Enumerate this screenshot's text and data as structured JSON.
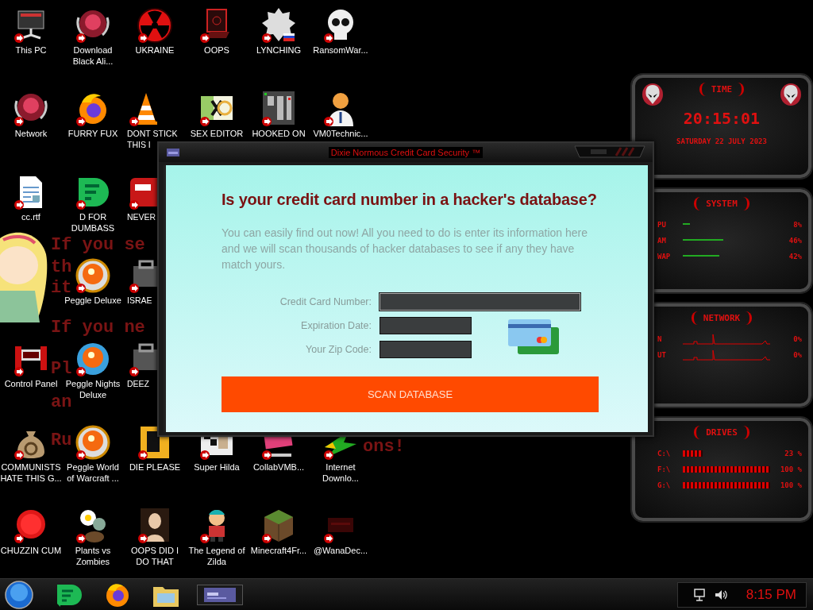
{
  "desktop": {
    "wallpaper_text": [
      "If you se",
      "th",
      "it",
      "If you ne",
      "Pl",
      "an",
      "Ru",
      "ons!"
    ],
    "icon_rows": [
      [
        {
          "label": "This PC",
          "covered": false
        },
        {
          "label": "Download Black Ali...",
          "covered": false
        },
        {
          "label": "UKRAINE",
          "covered": false
        },
        {
          "label": "OOPS",
          "covered": false
        },
        {
          "label": "LYNCHING",
          "covered": false
        },
        {
          "label": "RansomWar...",
          "covered": false
        }
      ],
      [
        {
          "label": "Network",
          "covered": false
        },
        {
          "label": "FURRY FUX",
          "covered": false
        },
        {
          "label": "DONT STICK THIS I",
          "covered": true
        },
        {
          "label": "SEX EDITOR",
          "covered": false
        },
        {
          "label": "HOOKED ON",
          "covered": false
        },
        {
          "label": "VM0Technic...",
          "covered": false
        }
      ],
      [
        {
          "label": "cc.rtf",
          "covered": false
        },
        {
          "label": "D FOR DUMBASS",
          "covered": false
        },
        {
          "label": "NEVER",
          "covered": true
        }
      ],
      [
        {
          "label": "Peggle Deluxe",
          "covered": false
        },
        {
          "label": "ISRAE",
          "covered": true
        }
      ],
      [
        {
          "label": "Control Panel",
          "covered": false
        },
        {
          "label": "Peggle Nights Deluxe",
          "covered": false
        },
        {
          "label": "DEEZ",
          "covered": true
        }
      ],
      [
        {
          "label": "COMMUNISTS HATE THIS G...",
          "covered": false
        },
        {
          "label": "Peggle World of Warcraft ...",
          "covered": false
        },
        {
          "label": "DIE PLEASE",
          "covered": false
        },
        {
          "label": "Super Hilda",
          "covered": false
        },
        {
          "label": "CollabVMB...",
          "covered": false
        },
        {
          "label": "Internet Downlo...",
          "covered": false
        }
      ],
      [
        {
          "label": "CHUZZIN CUM",
          "covered": false
        },
        {
          "label": "Plants vs Zombies",
          "covered": false
        },
        {
          "label": "OOPS DID I DO THAT",
          "covered": false
        },
        {
          "label": "The Legend of Zilda",
          "covered": false
        },
        {
          "label": "Minecraft4Fr...",
          "covered": false
        },
        {
          "label": "@WanaDec...",
          "covered": false
        }
      ]
    ]
  },
  "window": {
    "title": "Dixie Normous Credit Card Security ™",
    "heading": "Is your credit card number in a hacker's database?",
    "intro": "You can easily find out now! All you need to do is enter its information here and we will scan thousands of hacker databases to see if any they have match yours.",
    "fields": [
      {
        "label": "Credit Card Number:",
        "focused": true
      },
      {
        "label": "Expiration Date:",
        "focused": false
      },
      {
        "label": "Your Zip Code:",
        "focused": false
      }
    ],
    "button": "SCAN DATABASE"
  },
  "gadget": {
    "time": {
      "header": "TIME",
      "clock": "20:15:01",
      "date": "SATURDAY 22 JULY 2023"
    },
    "system": {
      "header": "SYSTEM",
      "rows": [
        {
          "label": "PU",
          "reading": "8%"
        },
        {
          "label": "AM",
          "reading": "46%"
        },
        {
          "label": "WAP",
          "reading": "42%"
        }
      ]
    },
    "network": {
      "header": "NETWORK",
      "rows": [
        {
          "label": "N",
          "reading": "0%"
        },
        {
          "label": "UT",
          "reading": "0%"
        }
      ]
    },
    "drives": {
      "header": "DRIVES",
      "rows": [
        {
          "label": "C:\\",
          "reading": "23 %"
        },
        {
          "label": "F:\\",
          "reading": "100 %"
        },
        {
          "label": "G:\\",
          "reading": "100 %"
        }
      ]
    }
  },
  "taskbar": {
    "clock": "8:15 PM"
  }
}
